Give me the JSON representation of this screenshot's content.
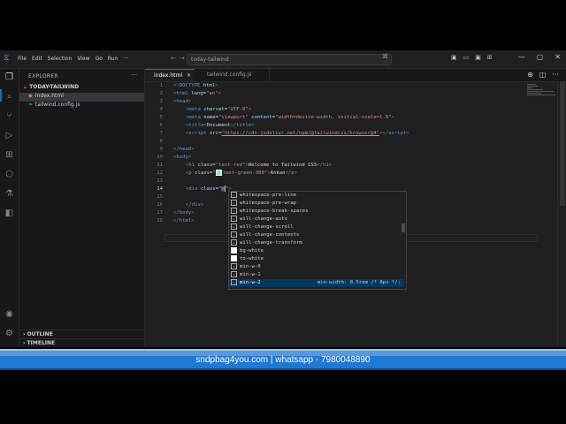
{
  "titlebar": {
    "menu": [
      "File",
      "Edit",
      "Selection",
      "View",
      "Go",
      "Run",
      "···"
    ],
    "command_center": "today-tailwind",
    "window_controls": [
      "—",
      "▢",
      "✕"
    ]
  },
  "sidebar": {
    "title": "EXPLORER",
    "folder": "TODAY-TAILWIND",
    "files": [
      {
        "name": "index.html",
        "selected": true
      },
      {
        "name": "tailwind.config.js",
        "selected": false
      }
    ],
    "sections": [
      "OUTLINE",
      "TIMELINE"
    ]
  },
  "tabs": [
    {
      "label": "index.html",
      "active": true
    },
    {
      "label": "tailwind.config.js",
      "active": false
    }
  ],
  "editor": {
    "current_line": 14,
    "line_numbers": [
      "1",
      "2",
      "3",
      "4",
      "5",
      "6",
      "7",
      "8",
      "9",
      "10",
      "11",
      "12",
      "13",
      "14",
      "15",
      "16",
      "17",
      "18"
    ],
    "lines": {
      "l1": {
        "a": "<!",
        "b": "DOCTYPE",
        "c": " html",
        "d": ">"
      },
      "l2": {
        "a": "<",
        "b": "html",
        "c": " lang",
        "d": "=",
        "e": "\"en\"",
        "f": ">"
      },
      "l3": {
        "a": "<",
        "b": "head",
        "c": ">"
      },
      "l4": {
        "a": "<",
        "b": "meta",
        "c": " charset",
        "d": "=",
        "e": "\"UTF-8\"",
        "f": ">"
      },
      "l5": {
        "a": "<",
        "b": "meta",
        "c": " name",
        "d": "=",
        "e": "\"viewport\"",
        "g": " content",
        "h": "=",
        "i": "\"width=device-width, initial-scale=1.0\"",
        "f": ">"
      },
      "l6": {
        "a": "<",
        "b": "title",
        "c": ">",
        "d": "Document",
        "e": "</",
        "f": "title",
        "g": ">"
      },
      "l7": {
        "a": "<",
        "b": "script",
        "c": " src",
        "d": "=",
        "e": "\"https://cdn.jsdelivr.net/npm/@tailwindcss/browser@4\"",
        "f": "></",
        "g": "script",
        "h": ">"
      },
      "l9": {
        "a": "</",
        "b": "head",
        "c": ">"
      },
      "l10": {
        "a": "<",
        "b": "body",
        "c": ">"
      },
      "l11": {
        "a": "<",
        "b": "h1",
        "c": " class",
        "d": "=",
        "e": "\"text-red\"",
        "f": ">",
        "g": "Welcome to Tailwind CSS",
        "h": "</",
        "i": "h1",
        "j": ">"
      },
      "l12": {
        "a": "<",
        "b": "p",
        "c": " class",
        "d": "=",
        "e": "\"",
        "s": "text-green-300\"",
        "f": ">",
        "g": "Ankan",
        "h": "</",
        "i": "p",
        "j": ">"
      },
      "l14": {
        "a": "<",
        "b": "div",
        "c": " class",
        "d": "=",
        "e": "\"",
        "m": "m",
        "q": "\"",
        "f": ">"
      },
      "l16": {
        "a": "</",
        "b": "div",
        "c": ">"
      },
      "l17": {
        "a": "</",
        "b": "body",
        "c": ">"
      },
      "l18": {
        "a": "</",
        "b": "html",
        "c": ">"
      }
    }
  },
  "suggestions": [
    {
      "label": "whitespace-pre-line",
      "kind": "value",
      "selected": false
    },
    {
      "label": "whitespace-pre-wrap",
      "kind": "value",
      "selected": false
    },
    {
      "label": "whitespace-break-spaces",
      "kind": "value",
      "selected": false
    },
    {
      "label": "will-change-auto",
      "kind": "value",
      "selected": false
    },
    {
      "label": "will-change-scroll",
      "kind": "value",
      "selected": false
    },
    {
      "label": "will-change-contents",
      "kind": "value",
      "selected": false
    },
    {
      "label": "will-change-transform",
      "kind": "value",
      "selected": false
    },
    {
      "label": "bg-white",
      "kind": "color",
      "selected": false
    },
    {
      "label": "to-white",
      "kind": "color",
      "selected": false
    },
    {
      "label": "min-w-0",
      "kind": "value",
      "selected": false
    },
    {
      "label": "min-w-1",
      "kind": "value",
      "selected": false
    },
    {
      "label": "min-w-2",
      "kind": "value",
      "selected": true,
      "detail": "min-width: 0.5rem /* 8px */;"
    }
  ],
  "banner": {
    "text": "sndpbag4you.com | whatsapp - 7980048890"
  },
  "colors": {
    "accent": "#0078d4",
    "banner": "#1f78d1",
    "editor_bg": "#1f1f1f",
    "tag": "#569cd6",
    "attr": "#9cdcfe",
    "string": "#ce9178"
  }
}
